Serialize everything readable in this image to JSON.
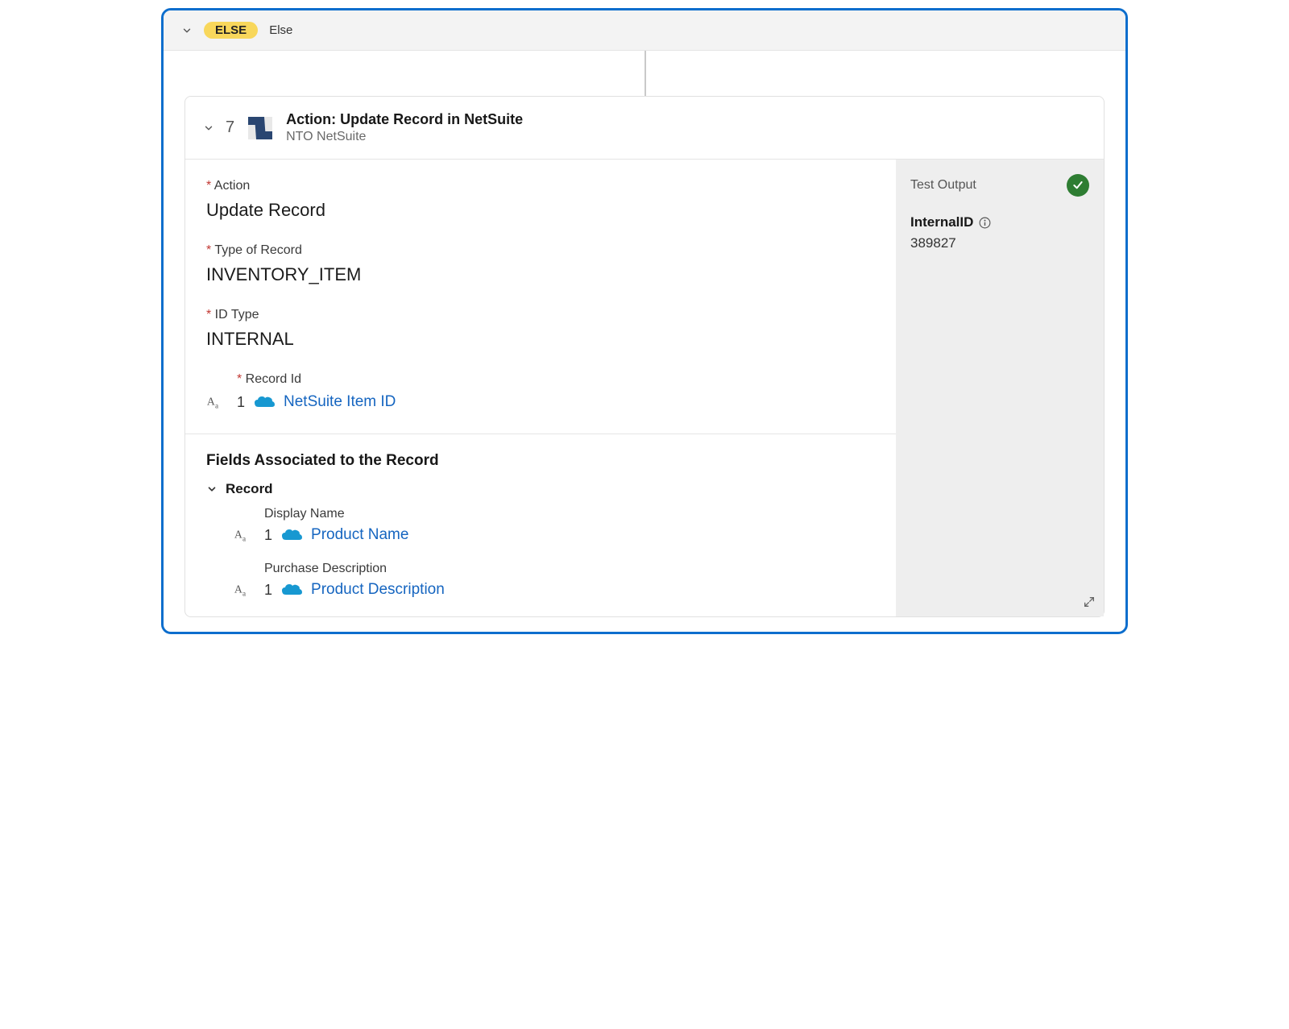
{
  "branch": {
    "badge": "ELSE",
    "label": "Else"
  },
  "step": {
    "number": "7",
    "title": "Action: Update Record in NetSuite",
    "subtitle": "NTO NetSuite",
    "fields": {
      "action": {
        "label": "Action",
        "value": "Update Record"
      },
      "typeOfRecord": {
        "label": "Type of Record",
        "value": "INVENTORY_ITEM"
      },
      "idType": {
        "label": "ID Type",
        "value": "INTERNAL"
      },
      "recordId": {
        "label": "Record Id",
        "ref": {
          "stepNum": "1",
          "name": "NetSuite Item ID"
        }
      }
    },
    "section": {
      "title": "Fields Associated to the Record",
      "recordHeader": "Record",
      "items": [
        {
          "label": "Display Name",
          "ref": {
            "stepNum": "1",
            "name": "Product Name"
          }
        },
        {
          "label": "Purchase Description",
          "ref": {
            "stepNum": "1",
            "name": "Product Description"
          }
        }
      ]
    },
    "testOutput": {
      "label": "Test Output",
      "key": "InternalID",
      "value": "389827"
    }
  }
}
